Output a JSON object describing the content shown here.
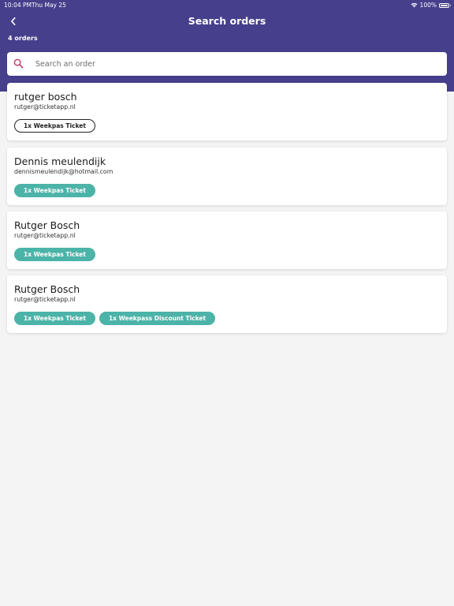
{
  "status_bar": {
    "time": "10:04 PM",
    "date": "Thu May 25",
    "battery": "100%"
  },
  "header": {
    "title": "Search orders",
    "order_count": "4 orders",
    "background": "#463f8c"
  },
  "search": {
    "placeholder": "Search an order",
    "value": "",
    "icon_color": "#c2426e"
  },
  "accent": "#4cb3a8",
  "orders": [
    {
      "name": "rutger bosch",
      "email": "rutger@ticketapp.nl",
      "tickets": [
        {
          "label": "1x Weekpas Ticket",
          "style": "outline"
        }
      ]
    },
    {
      "name": "Dennis meulendijk",
      "email": "dennismeulendijk@hotmail.com",
      "tickets": [
        {
          "label": "1x Weekpas Ticket",
          "style": "filled"
        }
      ]
    },
    {
      "name": "Rutger Bosch",
      "email": "rutger@ticketapp.nl",
      "tickets": [
        {
          "label": "1x Weekpas Ticket",
          "style": "filled"
        }
      ]
    },
    {
      "name": "Rutger Bosch",
      "email": "rutger@ticketapp.nl",
      "tickets": [
        {
          "label": "1x Weekpas Ticket",
          "style": "filled"
        },
        {
          "label": "1x Weekpass Discount Ticket",
          "style": "filled"
        }
      ]
    }
  ]
}
